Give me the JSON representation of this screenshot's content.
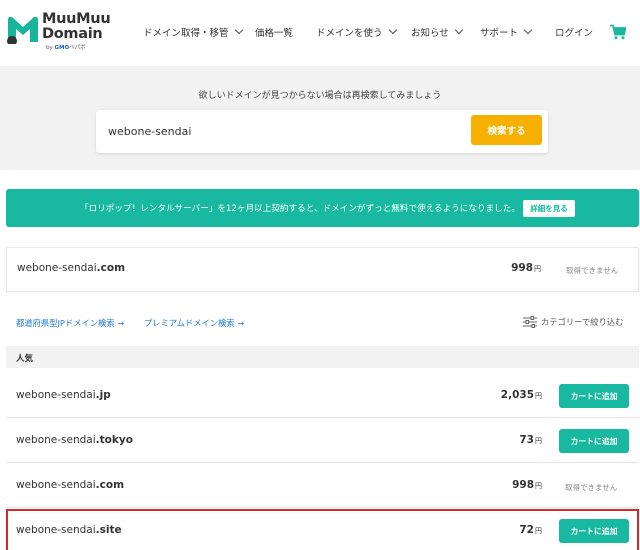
{
  "header": {
    "logo_line1": "MuuMuu",
    "logo_line2": "Domain",
    "logo_sub_by": "by",
    "logo_sub_gmo": "GMO",
    "logo_sub_rest": "ペパボ",
    "nav": [
      {
        "label": "ドメイン取得・移管",
        "has_dropdown": true
      },
      {
        "label": "価格一覧",
        "has_dropdown": false
      },
      {
        "label": "ドメインを使う",
        "has_dropdown": true
      },
      {
        "label": "お知らせ",
        "has_dropdown": true
      },
      {
        "label": "サポート",
        "has_dropdown": true
      },
      {
        "label": "ログイン",
        "has_dropdown": false
      }
    ],
    "cart_icon": "cart-icon"
  },
  "search": {
    "hint": "欲しいドメインが見つからない場合は再検索してみましょう",
    "value": "webone-sendai",
    "button": "検索する"
  },
  "promo": {
    "text": "「ロリポップ！レンタルサーバー」を12ヶ月以上契約すると、ドメインがずっと無料で使えるようになりました。",
    "button": "詳細を見る"
  },
  "top_result": {
    "name": "webone-sendai",
    "tld": ".com",
    "price": "998",
    "yen": "円",
    "status": "取得できません"
  },
  "links": {
    "jp_search": "都道府県型JPドメイン検索 →",
    "premium_search": "プレミアムドメイン検索 →",
    "filter": "カテゴリーで絞り込む"
  },
  "section": {
    "title": "人気",
    "rows": [
      {
        "name": "webone-sendai",
        "tld": ".jp",
        "price": "2,035",
        "yen": "円",
        "action": "カートに追加",
        "available": true,
        "highlighted": false
      },
      {
        "name": "webone-sendai",
        "tld": ".tokyo",
        "price": "73",
        "yen": "円",
        "action": "カートに追加",
        "available": true,
        "highlighted": false
      },
      {
        "name": "webone-sendai",
        "tld": ".com",
        "price": "998",
        "yen": "円",
        "action": "取得できません",
        "available": false,
        "highlighted": false
      },
      {
        "name": "webone-sendai",
        "tld": ".site",
        "price": "72",
        "yen": "円",
        "action": "カートに追加",
        "available": true,
        "highlighted": true
      }
    ]
  },
  "colors": {
    "accent_teal": "#18b9a0",
    "search_button": "#f6b100",
    "highlight_border": "#d22b2b",
    "link_blue": "#1e7bd8"
  }
}
